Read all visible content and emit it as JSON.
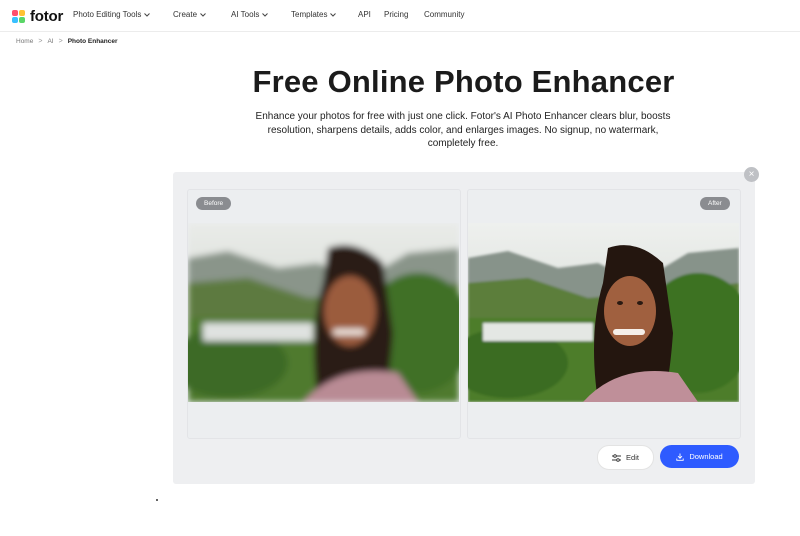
{
  "header": {
    "logo_text": "fotor",
    "nav": [
      {
        "label": "Photo Editing Tools",
        "has_menu": true
      },
      {
        "label": "Create",
        "has_menu": true
      },
      {
        "label": "AI Tools",
        "has_menu": true
      },
      {
        "label": "Templates",
        "has_menu": true
      },
      {
        "label": "API",
        "has_menu": false
      },
      {
        "label": "Pricing",
        "has_menu": false
      },
      {
        "label": "Community",
        "has_menu": false
      }
    ]
  },
  "breadcrumb": {
    "items": [
      "Home",
      "AI",
      "Photo Enhancer"
    ],
    "separator": ">"
  },
  "hero": {
    "title": "Free Online Photo Enhancer",
    "subtitle": "Enhance your photos for free with just one click. Fotor's AI Photo Enhancer clears blur, boosts resolution, sharpens details, adds color, and enlarges images. No signup, no watermark, completely free."
  },
  "workspace": {
    "close_icon": "×",
    "before_label": "Before",
    "after_label": "After",
    "edit_label": "Edit",
    "download_label": "Download"
  },
  "colors": {
    "accent": "#2e5bff",
    "panel_bg": "#eeeff1",
    "tag_bg": "#8a8c90"
  }
}
